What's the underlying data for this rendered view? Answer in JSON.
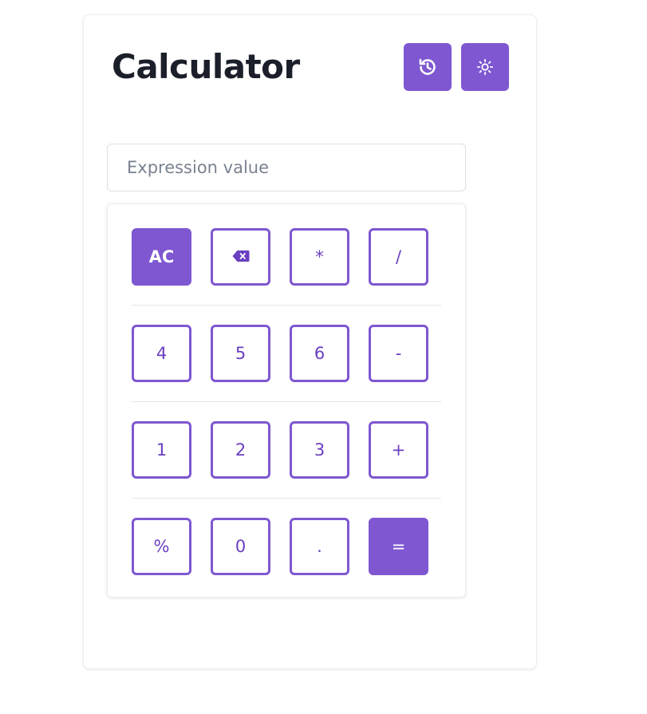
{
  "header": {
    "title": "Calculator"
  },
  "toolbar": {
    "history_icon": "history-icon",
    "theme_icon": "sun-icon"
  },
  "expression": {
    "value": "",
    "placeholder": "Expression value"
  },
  "keypad": {
    "rows": [
      [
        "AC",
        "",
        "*",
        "/"
      ],
      [
        "4",
        "5",
        "6",
        "-"
      ],
      [
        "1",
        "2",
        "3",
        "+"
      ],
      [
        "%",
        "0",
        ".",
        "="
      ]
    ],
    "backspace_icon": "backspace-icon"
  },
  "colors": {
    "accent": "#7e57d1",
    "accent_text": "#6a3fc0",
    "title": "#1b1f2a",
    "border": "#dcdfe4"
  }
}
